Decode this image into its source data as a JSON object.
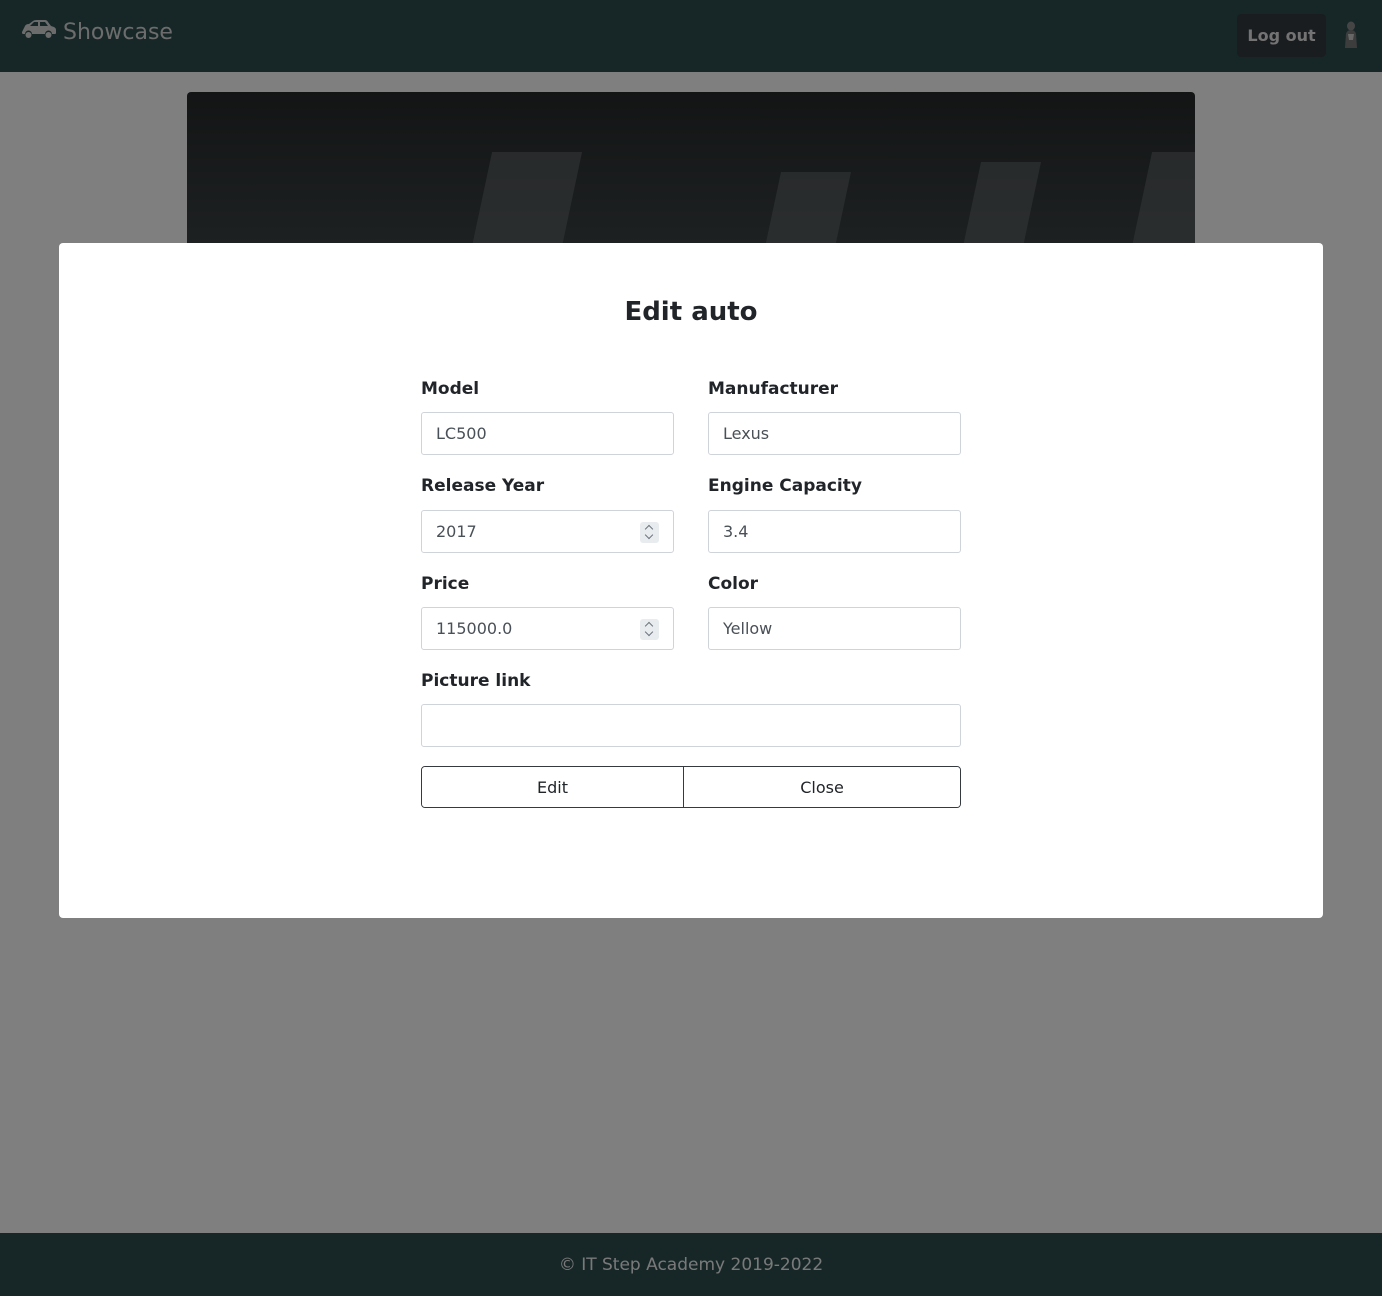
{
  "navbar": {
    "brand": "Showcase",
    "brand_icon": "car-icon",
    "logout_label": "Log out",
    "avatar_icon": "user-avatar-icon"
  },
  "modal": {
    "title": "Edit auto",
    "fields": {
      "model": {
        "label": "Model",
        "value": "LC500"
      },
      "manufacturer": {
        "label": "Manufacturer",
        "value": "Lexus"
      },
      "release_year": {
        "label": "Release Year",
        "value": "2017"
      },
      "engine_capacity": {
        "label": "Engine Capacity",
        "value": "3.4"
      },
      "price": {
        "label": "Price",
        "value": "115000.0"
      },
      "color": {
        "label": "Color",
        "value": "Yellow"
      },
      "picture_link": {
        "label": "Picture link",
        "value": ""
      }
    },
    "edit_label": "Edit",
    "close_label": "Close"
  },
  "footer": {
    "text": "© IT Step Academy 2019-2022"
  },
  "colors": {
    "navbar_bg": "#2f4f4f",
    "footer_bg": "#2f4f4f",
    "logout_bg": "#343a40"
  }
}
